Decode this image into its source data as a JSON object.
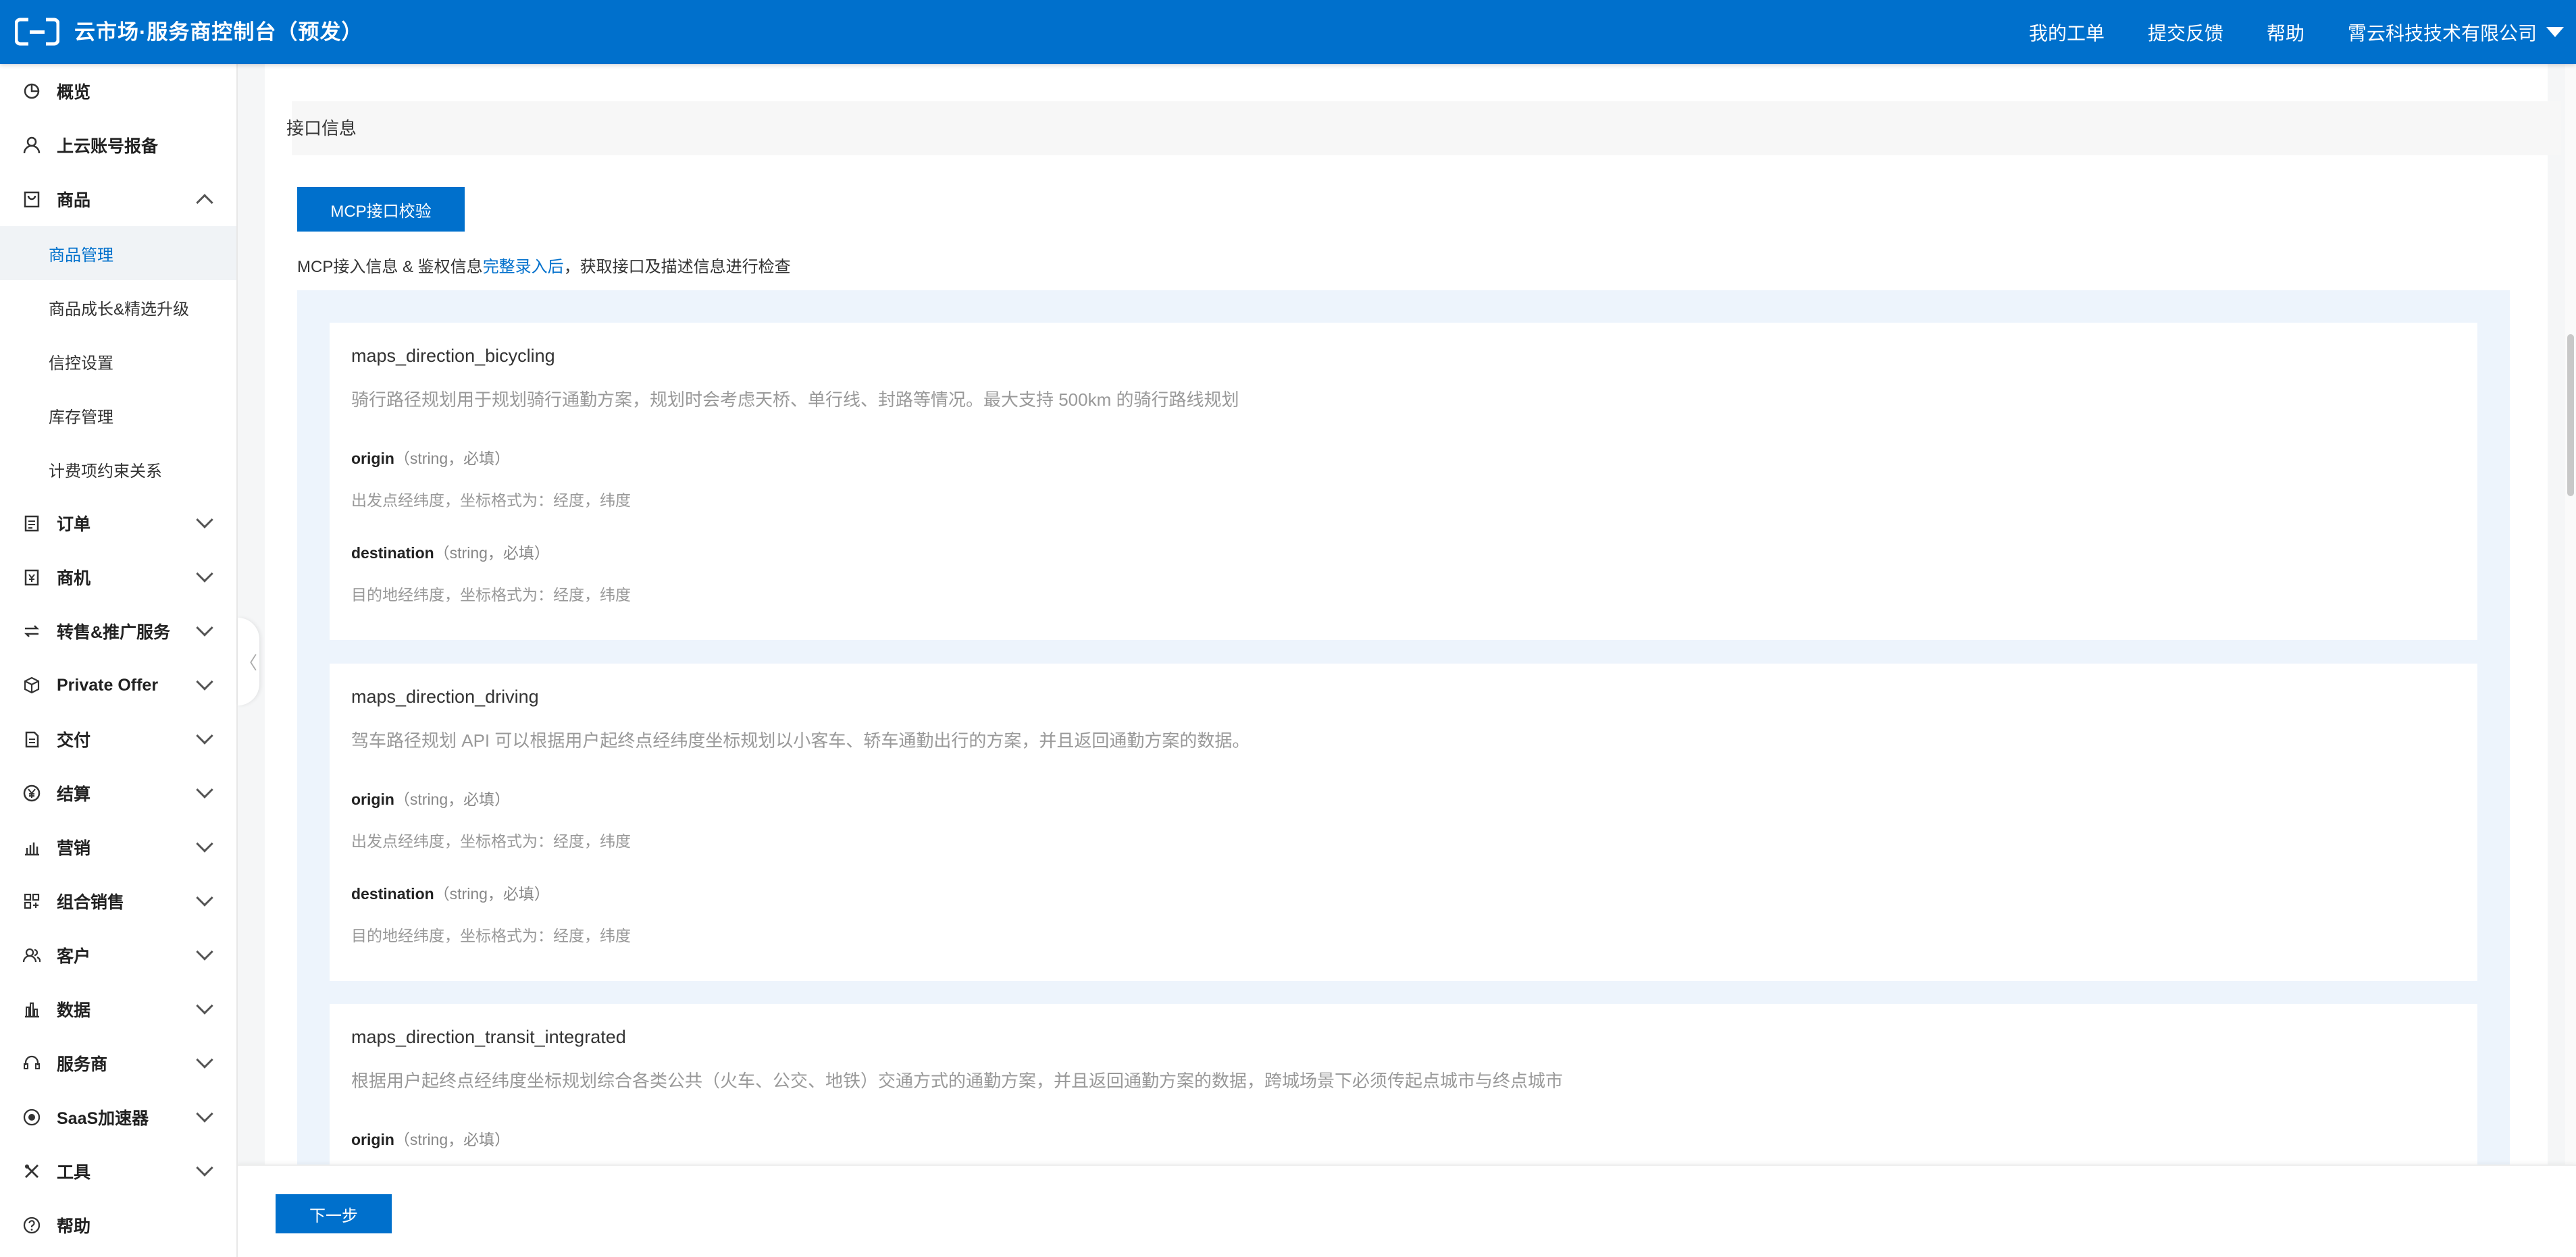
{
  "header": {
    "title": "云市场·服务商控制台（预发）",
    "nav": {
      "tickets": "我的工单",
      "feedback": "提交反馈",
      "help": "帮助",
      "company": "霄云科技技术有限公司"
    }
  },
  "sidebar": {
    "overview": "概览",
    "cloud_account": "上云账号报备",
    "products": "商品",
    "product_sub": {
      "manage": "商品管理",
      "growth": "商品成长&精选升级",
      "credit": "信控设置",
      "inventory": "库存管理",
      "billing": "计费项约束关系"
    },
    "orders": "订单",
    "opportunity": "商机",
    "resale": "转售&推广服务",
    "private_offer": "Private Offer",
    "delivery": "交付",
    "settlement": "结算",
    "marketing": "营销",
    "bundle": "组合销售",
    "customers": "客户",
    "data": "数据",
    "provider": "服务商",
    "saas": "SaaS加速器",
    "tools": "工具",
    "help": "帮助"
  },
  "main": {
    "section_title": "接口信息",
    "mcp_button": "MCP接口校验",
    "hint_pre": "MCP接入信息 & 鉴权信息",
    "hint_link": "完整录入后",
    "hint_post": "，获取接口及描述信息进行检查",
    "apis": [
      {
        "name": "maps_direction_bicycling",
        "desc": "骑行路径规划用于规划骑行通勤方案，规划时会考虑天桥、单行线、封路等情况。最大支持 500km 的骑行路线规划",
        "params": [
          {
            "name": "origin",
            "meta": "（string，必填）",
            "desc": "出发点经纬度，坐标格式为：经度，纬度"
          },
          {
            "name": "destination",
            "meta": "（string，必填）",
            "desc": "目的地经纬度，坐标格式为：经度，纬度"
          }
        ]
      },
      {
        "name": "maps_direction_driving",
        "desc": "驾车路径规划 API 可以根据用户起终点经纬度坐标规划以小客车、轿车通勤出行的方案，并且返回通勤方案的数据。",
        "params": [
          {
            "name": "origin",
            "meta": "（string，必填）",
            "desc": "出发点经纬度，坐标格式为：经度，纬度"
          },
          {
            "name": "destination",
            "meta": "（string，必填）",
            "desc": "目的地经纬度，坐标格式为：经度，纬度"
          }
        ]
      },
      {
        "name": "maps_direction_transit_integrated",
        "desc": "根据用户起终点经纬度坐标规划综合各类公共（火车、公交、地铁）交通方式的通勤方案，并且返回通勤方案的数据，跨城场景下必须传起点城市与终点城市",
        "params": [
          {
            "name": "origin",
            "meta": "（string，必填）",
            "desc": ""
          }
        ]
      }
    ]
  },
  "footer": {
    "next": "下一步"
  },
  "colors": {
    "primary": "#0070cc",
    "panel_bg": "#edf4fc"
  }
}
